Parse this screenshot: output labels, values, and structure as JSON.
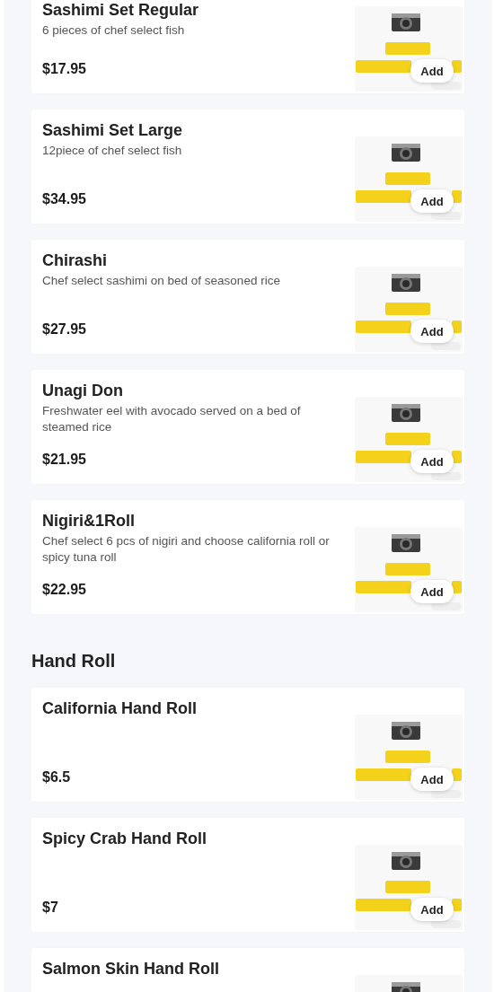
{
  "sections": [
    {
      "items": [
        {
          "name": "Sashimi Set Regular",
          "description": "6 pieces of chef select fish",
          "price": "$17.95",
          "button": "Add"
        },
        {
          "name": "Sashimi Set Large",
          "description": "12piece of chef select fish",
          "price": "$34.95",
          "button": "Add"
        },
        {
          "name": "Chirashi",
          "description": "Chef select sashimi on bed of seasoned rice",
          "price": "$27.95",
          "button": "Add"
        },
        {
          "name": "Unagi Don",
          "description": "Freshwater eel with avocado served on a bed of steamed rice",
          "price": "$21.95",
          "button": "Add"
        },
        {
          "name": "Nigiri&1Roll",
          "description": "Chef select 6 pcs of nigiri and choose california roll or spicy tuna roll",
          "price": "$22.95",
          "button": "Add"
        }
      ]
    },
    {
      "title": "Hand Roll",
      "items": [
        {
          "name": "California Hand Roll",
          "price": "$6.5",
          "button": "Add"
        },
        {
          "name": "Spicy Crab Hand Roll",
          "price": "$7",
          "button": "Add"
        },
        {
          "name": "Salmon Skin Hand Roll"
        }
      ]
    }
  ]
}
